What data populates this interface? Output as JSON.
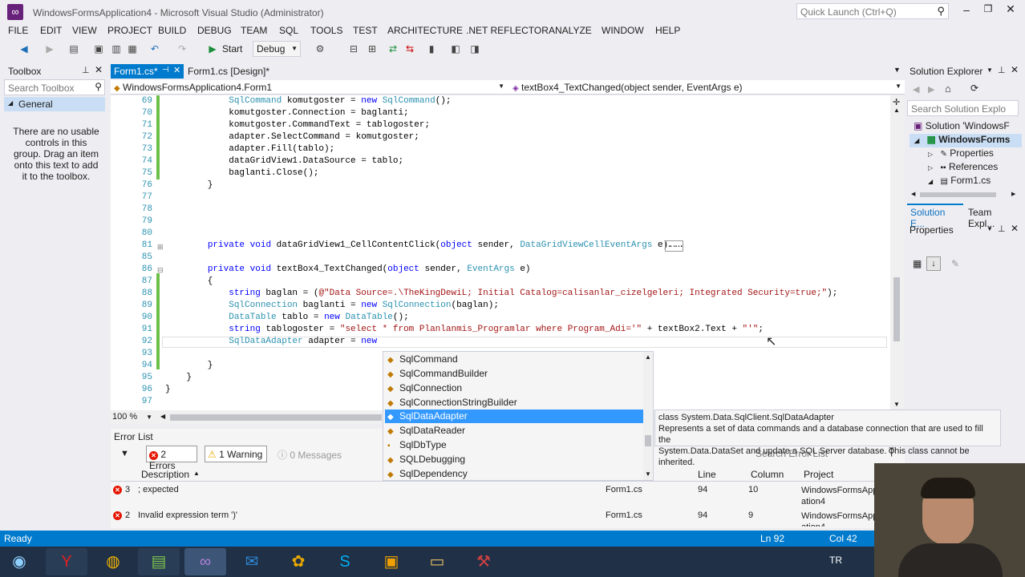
{
  "window": {
    "title": "WindowsFormsApplication4 - Microsoft Visual Studio (Administrator)",
    "quick_launch": "Quick Launch (Ctrl+Q)"
  },
  "menu": [
    "FILE",
    "EDIT",
    "VIEW",
    "PROJECT",
    "BUILD",
    "DEBUG",
    "TEAM",
    "SQL",
    "TOOLS",
    "TEST",
    "ARCHITECTURE",
    ".NET REFLECTOR",
    "ANALYZE",
    "WINDOW",
    "HELP"
  ],
  "toolbar": {
    "start": "Start",
    "config": "Debug"
  },
  "toolbox": {
    "title": "Toolbox",
    "search": "Search Toolbox",
    "group": "General",
    "empty_message": "There are no usable controls in this group. Drag an item onto this text to add it to the toolbox."
  },
  "tabs": {
    "active": "Form1.cs*",
    "design": "Form1.cs [Design]*"
  },
  "nav": {
    "class": "WindowsFormsApplication4.Form1",
    "member": "textBox4_TextChanged(object sender, EventArgs e)"
  },
  "code": [
    {
      "n": "69",
      "t": "            SqlCommand komutgoster = new SqlCommand();"
    },
    {
      "n": "70",
      "t": "            komutgoster.Connection = baglanti;"
    },
    {
      "n": "71",
      "t": "            komutgoster.CommandText = tablogoster;"
    },
    {
      "n": "72",
      "t": "            adapter.SelectCommand = komutgoster;"
    },
    {
      "n": "73",
      "t": "            adapter.Fill(tablo);"
    },
    {
      "n": "74",
      "t": "            dataGridView1.DataSource = tablo;"
    },
    {
      "n": "75",
      "t": "            baglanti.Close();"
    },
    {
      "n": "76",
      "t": "        }"
    },
    {
      "n": "77",
      "t": ""
    },
    {
      "n": "78",
      "t": ""
    },
    {
      "n": "79",
      "t": ""
    },
    {
      "n": "80",
      "t": ""
    },
    {
      "n": "81",
      "t": "        private void dataGridView1_CellContentClick(object sender, DataGridViewCellEventArgs e)..."
    },
    {
      "n": "85",
      "t": ""
    },
    {
      "n": "86",
      "t": "        private void textBox4_TextChanged(object sender, EventArgs e)"
    },
    {
      "n": "87",
      "t": "        {"
    },
    {
      "n": "88",
      "t": "            string baglan = (@\"Data Source=.\\TheKingDewiL; Initial Catalog=calisanlar_cizelgeleri; Integrated Security=true;\");"
    },
    {
      "n": "89",
      "t": "            SqlConnection baglanti = new SqlConnection(baglan);"
    },
    {
      "n": "90",
      "t": "            DataTable tablo = new DataTable();"
    },
    {
      "n": "91",
      "t": "            string tablogoster = \"select * from Planlanmis_Programlar where Program_Adi='\" + textBox2.Text + \"'\";"
    },
    {
      "n": "92",
      "t": "            SqlDataAdapter adapter = new "
    },
    {
      "n": "93",
      "t": ""
    },
    {
      "n": "94",
      "t": "        }"
    },
    {
      "n": "95",
      "t": "    }"
    },
    {
      "n": "96",
      "t": "}"
    },
    {
      "n": "97",
      "t": ""
    }
  ],
  "zoom": "100 %",
  "completion": {
    "items": [
      "SqlCommand",
      "SqlCommandBuilder",
      "SqlConnection",
      "SqlConnectionStringBuilder",
      "SqlDataAdapter",
      "SqlDataReader",
      "SqlDbType",
      "SQLDebugging",
      "SqlDependency"
    ],
    "selected": "SqlDataAdapter"
  },
  "tooltip": {
    "line1": "class System.Data.SqlClient.SqlDataAdapter",
    "line2": "Represents a set of data commands and a database connection that are used to fill the",
    "line3": "System.Data.DataSet and update a SQL Server database. This class cannot be inherited."
  },
  "errors": {
    "title": "Error List",
    "errors_btn": "2 Errors",
    "warnings_btn": "1 Warning",
    "messages_btn": "0 Messages",
    "search": "Search Error List",
    "columns": [
      "Description",
      "Line",
      "Column",
      "Project"
    ],
    "rows": [
      {
        "num": "3",
        "desc": "; expected",
        "file": "Form1.cs",
        "line": "94",
        "col": "10",
        "project": "WindowsFormsApp ation4"
      },
      {
        "num": "2",
        "desc": "Invalid expression term ')'",
        "file": "Form1.cs",
        "line": "94",
        "col": "9",
        "project": "WindowsFormsApp ation4"
      }
    ]
  },
  "solution_explorer": {
    "title": "Solution Explorer",
    "search": "Search Solution Explo",
    "items": [
      "Solution 'WindowsF",
      "WindowsForms",
      "Properties",
      "References",
      "Form1.cs"
    ],
    "tab1": "Solution E...",
    "tab2": "Team Expl..."
  },
  "properties": {
    "title": "Properties"
  },
  "status": {
    "ready": "Ready",
    "ln": "Ln 92",
    "col": "Col 42"
  },
  "taskbar": {
    "lang": "TR"
  }
}
